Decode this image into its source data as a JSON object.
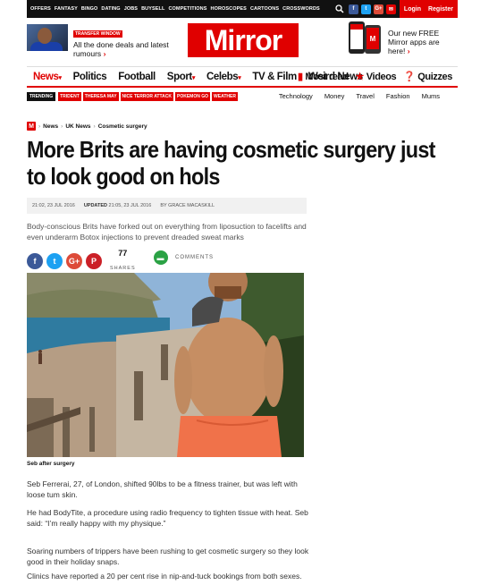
{
  "topbar": {
    "links": [
      "OFFERS",
      "FANTASY",
      "BINGO",
      "DATING",
      "JOBS",
      "BUYSELL",
      "COMPETITIONS",
      "HOROSCOPES",
      "CARTOONS",
      "CROSSWORDS"
    ],
    "social": [
      {
        "name": "facebook-icon",
        "glyph": "f",
        "color": "#3b5998"
      },
      {
        "name": "twitter-icon",
        "glyph": "t",
        "color": "#1da1f2"
      },
      {
        "name": "googleplus-icon",
        "glyph": "G+",
        "color": "#dd4b39"
      },
      {
        "name": "email-icon",
        "glyph": "✉",
        "color": "#e00000"
      }
    ],
    "login": "Login",
    "register": "Register"
  },
  "header": {
    "promo_tag": "TRANSFER WINDOW",
    "promo_title": "All the done deals and latest rumours",
    "logo": "Mirror",
    "app_text": "Our new FREE Mirror apps are here!"
  },
  "nav": {
    "items": [
      {
        "label": "News",
        "caret": true
      },
      {
        "label": "Politics",
        "caret": false
      },
      {
        "label": "Football",
        "caret": false
      },
      {
        "label": "Sport",
        "caret": true
      },
      {
        "label": "Celebs",
        "caret": true
      },
      {
        "label": "TV & Film",
        "caret": false
      },
      {
        "label": "Weird News",
        "caret": false
      }
    ],
    "right": [
      "Most read",
      "Videos",
      "Quizzes"
    ]
  },
  "trending": {
    "label": "TRENDING",
    "tags": [
      "TRIDENT",
      "THERESA MAY",
      "NICE TERROR ATTACK",
      "POKEMON GO",
      "WEATHER"
    ],
    "right": [
      "Technology",
      "Money",
      "Travel",
      "Fashion",
      "Mums"
    ]
  },
  "breadcrumb": [
    "News",
    "UK News",
    "Cosmetic surgery"
  ],
  "article": {
    "headline": "More Brits are having cosmetic surgery just to look good on hols",
    "published": "21:02, 23 JUL 2016",
    "updated_label": "UPDATED",
    "updated": "21:05, 23 JUL 2016",
    "by_label": "BY",
    "author": "GRACE MACASKILL",
    "standfirst": "Body-conscious Brits have forked out on everything from liposuction to facelifts and even underarm Botox injections to prevent dreaded sweat marks",
    "shares_count": "77",
    "shares_label": "SHARES",
    "comments_label": "COMMENTS",
    "caption": "Seb after surgery",
    "paragraphs": [
      "Seb Ferrerai, 27, of London, shifted 90lbs to be a fitness trainer, but was left with loose tum skin.",
      "He had BodyTite, a procedure using radio frequency to tighten tissue with heat. Seb said: “I’m really happy with my physique.”",
      "Soaring numbers of trippers have been rushing to get cosmetic surgery so they look good in their holiday snaps.",
      "Clinics have reported a 20 per cent rise in nip-and-tuck bookings from both sexes."
    ]
  },
  "share_buttons": [
    {
      "name": "share-facebook-button",
      "glyph": "f",
      "color": "#3b5998"
    },
    {
      "name": "share-twitter-button",
      "glyph": "t",
      "color": "#1da1f2"
    },
    {
      "name": "share-googleplus-button",
      "glyph": "G+",
      "color": "#dd4b39"
    },
    {
      "name": "share-pinterest-button",
      "glyph": "P",
      "color": "#cb2027"
    }
  ]
}
